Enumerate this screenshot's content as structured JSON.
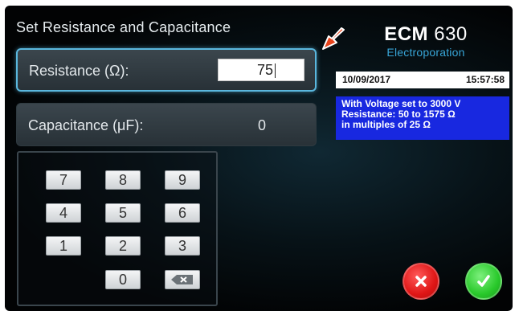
{
  "title": "Set Resistance and Capacitance",
  "resistance": {
    "label": "Resistance (Ω):",
    "value": "75"
  },
  "capacitance": {
    "label": "Capacitance (μF):",
    "value": "0"
  },
  "keypad": {
    "keys": [
      "7",
      "8",
      "9",
      "4",
      "5",
      "6",
      "1",
      "2",
      "3",
      "0"
    ],
    "backspace_icon": "backspace-icon"
  },
  "logo": {
    "brand": "ECM",
    "model": "630",
    "subtitle": "Electroporation"
  },
  "status": {
    "date": "10/09/2017",
    "time": "15:57:58"
  },
  "info": [
    "With Voltage set to 3000 V",
    "Resistance: 50 to 1575 Ω",
    "in multiples of 25 Ω"
  ],
  "buttons": {
    "cancel_icon": "close-icon",
    "confirm_icon": "check-icon"
  },
  "colors": {
    "accent_blue": "#38a6d8",
    "info_background": "#1828e0",
    "cancel_red": "#e01616",
    "confirm_green": "#29c92b",
    "pointer_arrow": "#e8441c"
  }
}
